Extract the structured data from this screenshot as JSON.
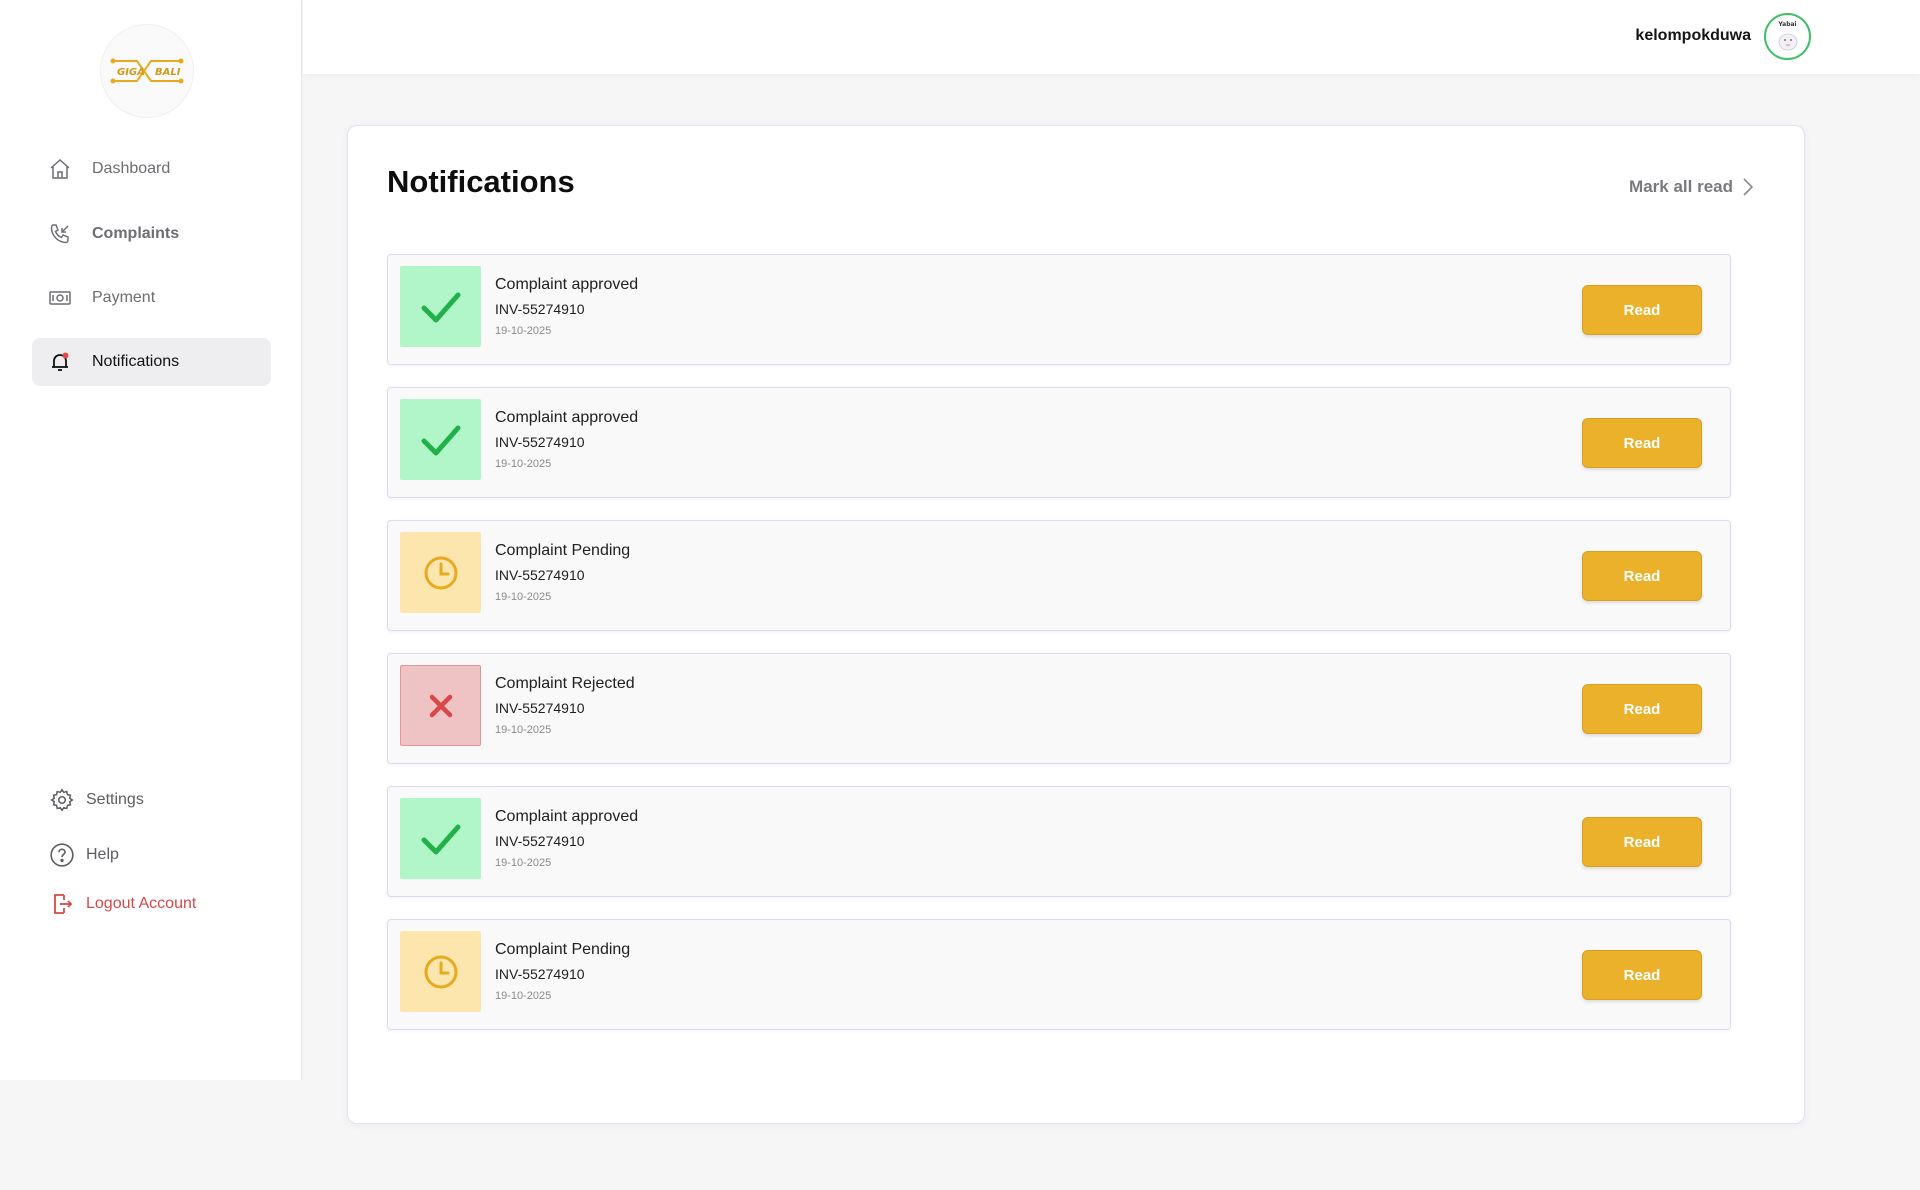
{
  "sidebar": {
    "logo_alt": "GIGA BALI",
    "nav": [
      {
        "label": "Dashboard",
        "icon": "home-icon"
      },
      {
        "label": "Complaints",
        "icon": "phone-incoming-icon"
      },
      {
        "label": "Payment",
        "icon": "money-icon"
      },
      {
        "label": "Notifications",
        "icon": "bell-icon",
        "active": true
      }
    ],
    "bottom": [
      {
        "label": "Settings",
        "icon": "gear-icon"
      },
      {
        "label": "Help",
        "icon": "help-icon"
      },
      {
        "label": "Logout Account",
        "icon": "logout-icon"
      }
    ]
  },
  "topbar": {
    "username": "kelompokduwa",
    "avatar_text": "Yabai"
  },
  "main": {
    "title": "Notifications",
    "mark_all_label": "Mark all read",
    "notifications": [
      {
        "status": "approved",
        "title": "Complaint approved",
        "invoice": "INV-55274910",
        "date": "19-10-2025",
        "button": "Read"
      },
      {
        "status": "approved",
        "title": "Complaint approved",
        "invoice": "INV-55274910",
        "date": "19-10-2025",
        "button": "Read"
      },
      {
        "status": "pending",
        "title": "Complaint Pending",
        "invoice": "INV-55274910",
        "date": "19-10-2025",
        "button": "Read"
      },
      {
        "status": "rejected",
        "title": "Complaint Rejected",
        "invoice": "INV-55274910",
        "date": "19-10-2025",
        "button": "Read"
      },
      {
        "status": "approved",
        "title": "Complaint approved",
        "invoice": "INV-55274910",
        "date": "19-10-2025",
        "button": "Read"
      },
      {
        "status": "pending",
        "title": "Complaint Pending",
        "invoice": "INV-55274910",
        "date": "19-10-2025",
        "button": "Read"
      }
    ]
  },
  "colors": {
    "accent": "#ebb12a",
    "approved_bg": "#b0f6c8",
    "approved_icon": "#22b04b",
    "pending_bg": "#fde6ad",
    "pending_icon": "#e9a91f",
    "rejected_bg": "#efc3c3",
    "rejected_icon": "#d94848",
    "logout_text": "#d94848"
  }
}
